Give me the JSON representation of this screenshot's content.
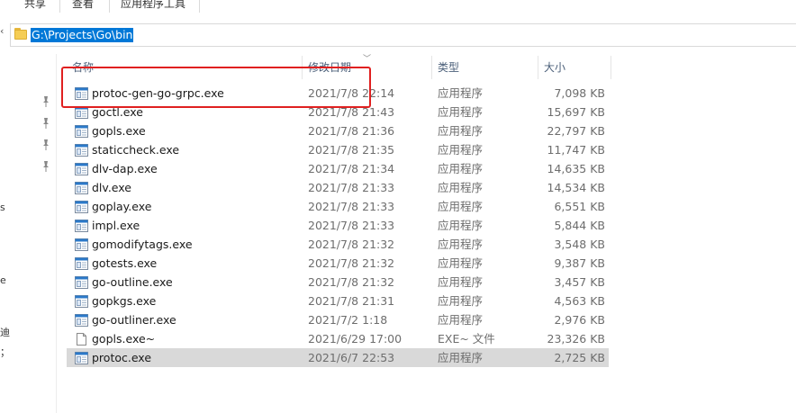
{
  "ribbon": {
    "tabs": [
      "共享",
      "查看",
      "应用程序工具"
    ]
  },
  "address": {
    "path": "G:\\Projects\\Go\\bin"
  },
  "nav": {
    "fragments": [
      "s",
      "e",
      "迪",
      "；"
    ]
  },
  "columns": {
    "name": "名称",
    "date": "修改日期",
    "type": "类型",
    "size": "大小"
  },
  "files": [
    {
      "name": "protoc-gen-go-grpc.exe",
      "date": "2021/7/8 22:14",
      "type": "应用程序",
      "size": "7,098 KB",
      "icon": "exe-icon"
    },
    {
      "name": "goctl.exe",
      "date": "2021/7/8 21:43",
      "type": "应用程序",
      "size": "15,697 KB",
      "icon": "exe-icon"
    },
    {
      "name": "gopls.exe",
      "date": "2021/7/8 21:36",
      "type": "应用程序",
      "size": "22,797 KB",
      "icon": "exe-icon"
    },
    {
      "name": "staticcheck.exe",
      "date": "2021/7/8 21:35",
      "type": "应用程序",
      "size": "11,747 KB",
      "icon": "exe-icon"
    },
    {
      "name": "dlv-dap.exe",
      "date": "2021/7/8 21:34",
      "type": "应用程序",
      "size": "14,635 KB",
      "icon": "exe-icon"
    },
    {
      "name": "dlv.exe",
      "date": "2021/7/8 21:33",
      "type": "应用程序",
      "size": "14,534 KB",
      "icon": "exe-icon"
    },
    {
      "name": "goplay.exe",
      "date": "2021/7/8 21:33",
      "type": "应用程序",
      "size": "6,551 KB",
      "icon": "exe-icon"
    },
    {
      "name": "impl.exe",
      "date": "2021/7/8 21:33",
      "type": "应用程序",
      "size": "5,844 KB",
      "icon": "exe-icon"
    },
    {
      "name": "gomodifytags.exe",
      "date": "2021/7/8 21:32",
      "type": "应用程序",
      "size": "3,548 KB",
      "icon": "exe-icon"
    },
    {
      "name": "gotests.exe",
      "date": "2021/7/8 21:32",
      "type": "应用程序",
      "size": "9,387 KB",
      "icon": "exe-icon"
    },
    {
      "name": "go-outline.exe",
      "date": "2021/7/8 21:32",
      "type": "应用程序",
      "size": "3,457 KB",
      "icon": "exe-icon"
    },
    {
      "name": "gopkgs.exe",
      "date": "2021/7/8 21:31",
      "type": "应用程序",
      "size": "4,563 KB",
      "icon": "exe-icon"
    },
    {
      "name": "go-outliner.exe",
      "date": "2021/7/2 1:18",
      "type": "应用程序",
      "size": "2,976 KB",
      "icon": "exe-icon"
    },
    {
      "name": "gopls.exe~",
      "date": "2021/6/29 17:00",
      "type": "EXE~ 文件",
      "size": "23,326 KB",
      "icon": "file-icon"
    },
    {
      "name": "protoc.exe",
      "date": "2021/6/7 22:53",
      "type": "应用程序",
      "size": "2,725 KB",
      "icon": "exe-icon",
      "selected": true
    }
  ],
  "colors": {
    "selection": "#0078d7",
    "highlight_box": "#e02020",
    "row_selected": "#d9d9d9"
  }
}
